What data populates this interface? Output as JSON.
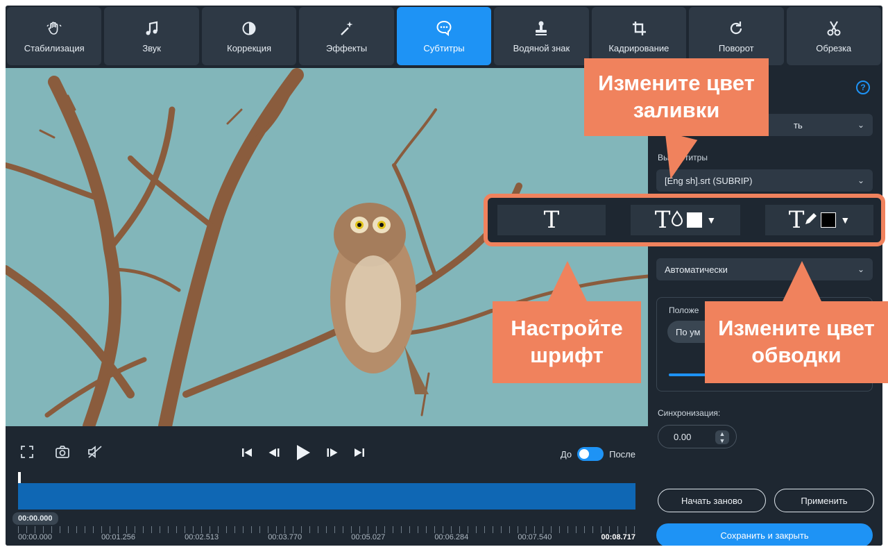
{
  "toolbar": {
    "tools": [
      {
        "label": "Стабилизация",
        "icon": "hand-icon"
      },
      {
        "label": "Звук",
        "icon": "music-note-icon"
      },
      {
        "label": "Коррекция",
        "icon": "contrast-icon"
      },
      {
        "label": "Эффекты",
        "icon": "magic-wand-icon"
      },
      {
        "label": "Субтитры",
        "icon": "speech-bubble-icon",
        "active": true
      },
      {
        "label": "Водяной знак",
        "icon": "stamp-icon"
      },
      {
        "label": "Кадрирование",
        "icon": "crop-icon"
      },
      {
        "label": "Поворот",
        "icon": "rotate-icon"
      },
      {
        "label": "Обрезка",
        "icon": "scissors-icon"
      }
    ]
  },
  "panel": {
    "help": "?",
    "mode_select_tail": "ть",
    "subtitles_label": "Выберите субтитры",
    "subtitles_label_visible": "Вы  субтитры",
    "subtitles_value": "[English].srt (SUBRIP)",
    "subtitles_value_visible": "[Eng  sh].srt (SUBRIP)",
    "encoding_select": "Автоматически",
    "position_label": "Положе",
    "position_value": "По ум",
    "sync_label": "Синхронизация:",
    "sync_value": "0.00",
    "restart_button": "Начать заново",
    "apply_button": "Применить",
    "save_close_button": "Сохранить и закрыть"
  },
  "controls": {
    "before_label": "До",
    "after_label": "После",
    "current_time": "00:00.000",
    "tick_labels": [
      "00:00.000",
      "00:01.256",
      "00:02.513",
      "00:03.770",
      "00:05.027",
      "00:06.284",
      "00:07.540",
      "00:08.717"
    ]
  },
  "font_bar": {
    "font_glyph": "T",
    "fill_glyph": "T",
    "outline_glyph": "T",
    "fill_color": "#ffffff",
    "outline_color": "#000000"
  },
  "callouts": {
    "fill_color": "Измените цвет заливки",
    "font": "Настройте шрифт",
    "outline_color": "Измените цвет обводки"
  },
  "colors": {
    "accent": "#1e93f5",
    "callout": "#f0825d",
    "app_bg": "#1e2731",
    "panel_bg": "#2e3945"
  }
}
